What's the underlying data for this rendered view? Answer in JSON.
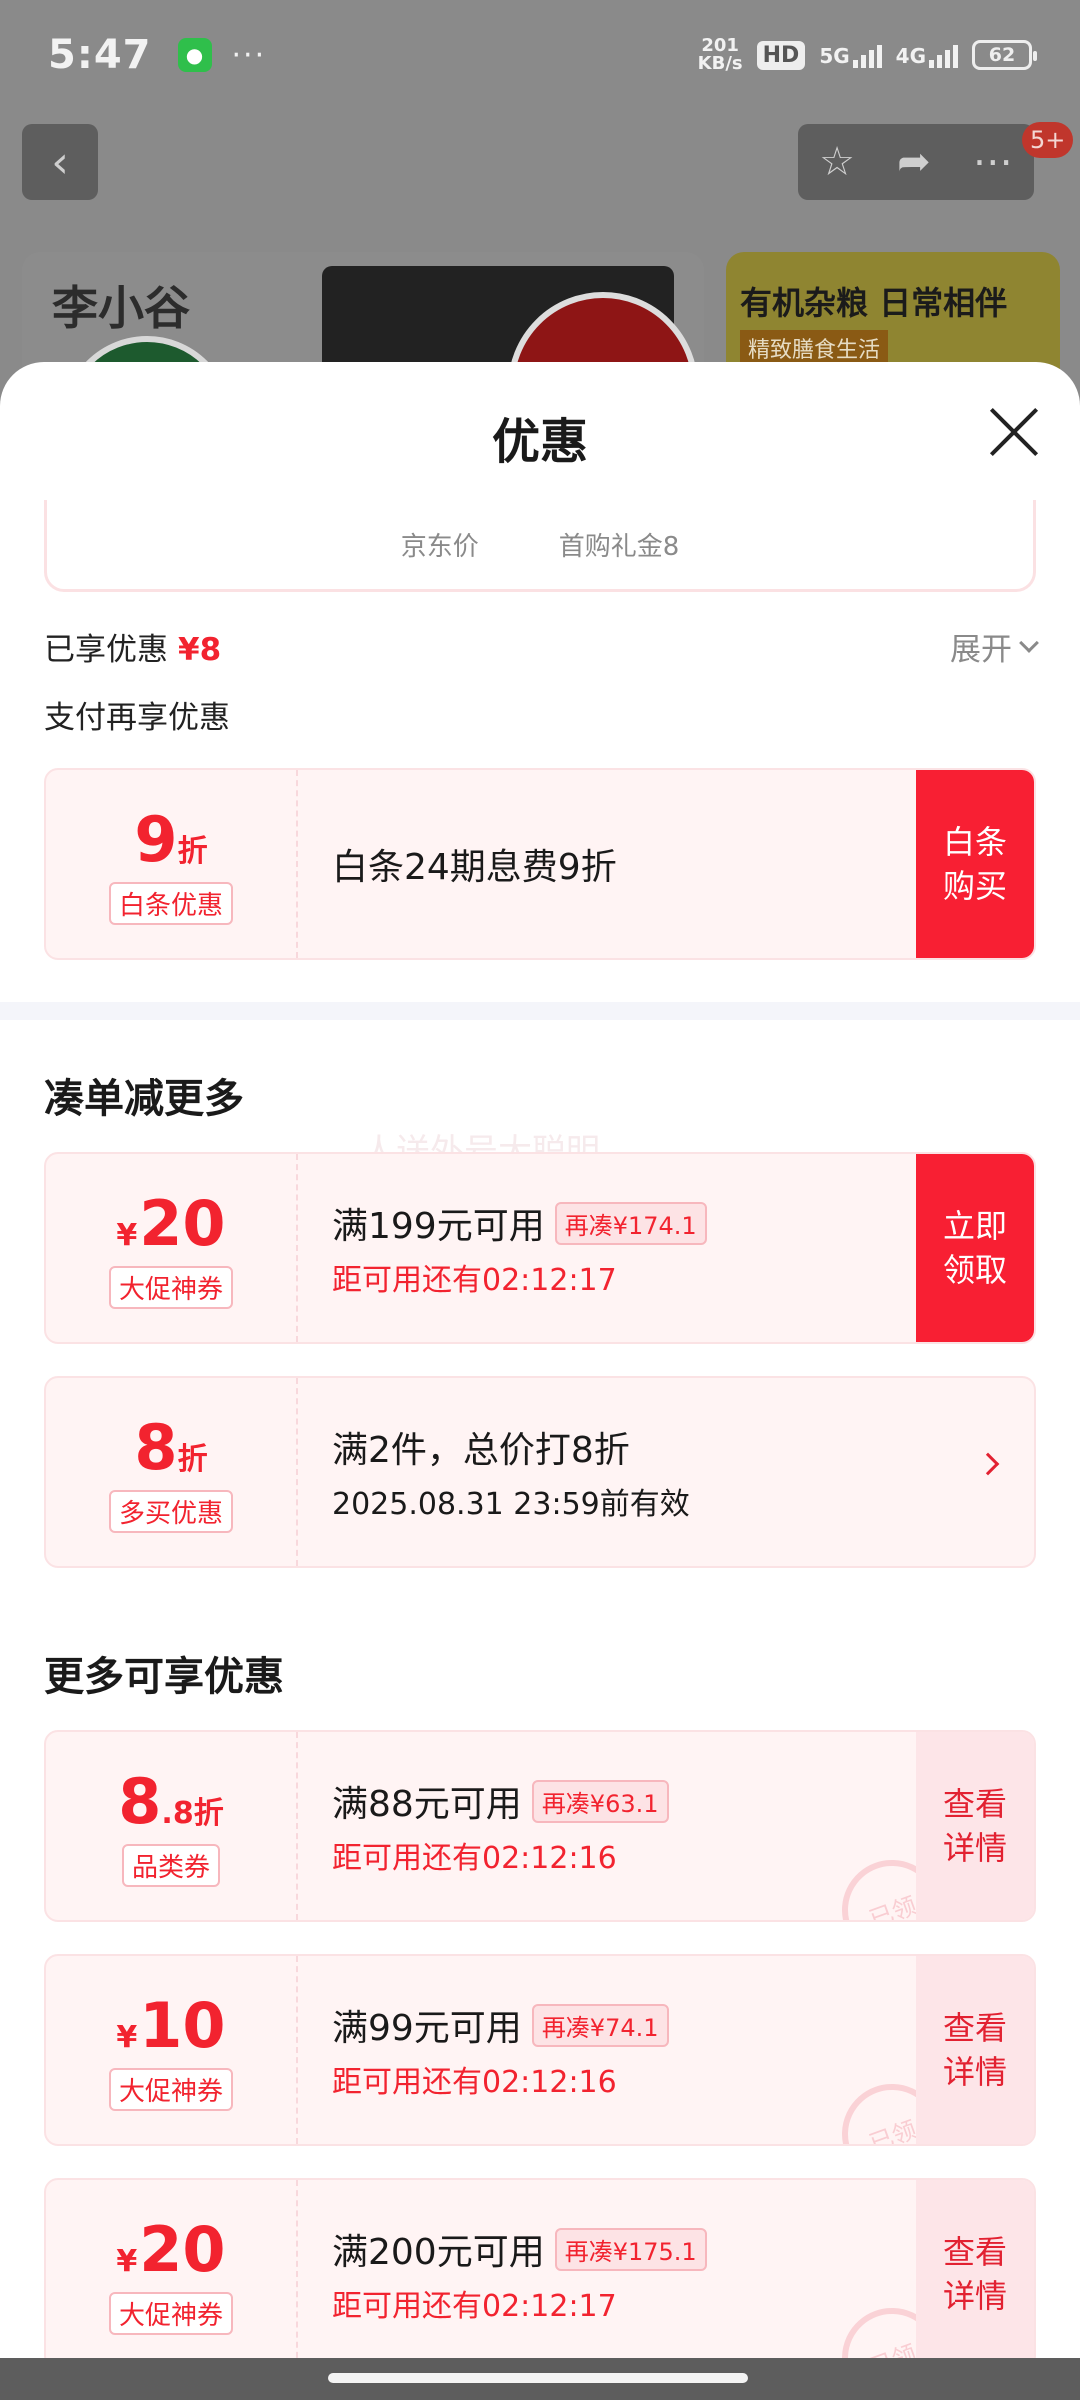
{
  "status_bar": {
    "time": "5:47",
    "speed_top": "201",
    "speed_unit": "KB/s",
    "hd": "HD",
    "net1": "5G",
    "net2": "4G",
    "battery": "62"
  },
  "background": {
    "badge": "5+",
    "brand_logo": "李小谷",
    "banner2_title": "有机杂粮 日常相伴",
    "banner2_sub": "精致膳食生活"
  },
  "sheet": {
    "title": "优惠",
    "price_labels": [
      "京东价",
      "首购礼金8"
    ],
    "enjoyed_label": "已享优惠",
    "enjoyed_amount": "¥8",
    "expand_label": "展开",
    "pay_more_label": "支付再享优惠"
  },
  "baitiao": {
    "value": "9",
    "unit": "折",
    "tag": "白条优惠",
    "text": "白条24期息费9折",
    "button": "白条购买"
  },
  "section1": {
    "title": "凑单减更多",
    "watermark": "人送外号大聪明",
    "coupons": [
      {
        "yen": "¥",
        "value": "20",
        "tag": "大促神券",
        "condition": "满199元可用",
        "pill": "再凑¥174.1",
        "sub": "距可用还有02:12:17",
        "button": "立即领取"
      },
      {
        "value": "8",
        "unit": "折",
        "tag": "多买优惠",
        "condition": "满2件，总价打8折",
        "sub": "2025.08.31 23:59前有效"
      }
    ]
  },
  "section2": {
    "title": "更多可享优惠",
    "coupons": [
      {
        "value": "8",
        "value_small": ".8折",
        "tag": "品类券",
        "condition": "满88元可用",
        "pill": "再凑¥63.1",
        "sub": "距可用还有02:12:16",
        "button": "查看详情",
        "stamp": "已领"
      },
      {
        "yen": "¥",
        "value": "10",
        "tag": "大促神券",
        "condition": "满99元可用",
        "pill": "再凑¥74.1",
        "sub": "距可用还有02:12:16",
        "button": "查看详情",
        "stamp": "已领"
      },
      {
        "yen": "¥",
        "value": "20",
        "tag": "大促神券",
        "condition": "满200元可用",
        "pill": "再凑¥175.1",
        "sub": "距可用还有02:12:17",
        "button": "查看详情",
        "stamp": "已领"
      }
    ]
  },
  "icons": {
    "back": "chevron-left-icon",
    "star": "star-icon",
    "share": "share-icon",
    "more": "more-dots-icon",
    "close": "close-icon"
  },
  "colors": {
    "accent_red": "#f2232f",
    "button_red": "#f81f33",
    "coupon_bg": "#fff4f4"
  }
}
